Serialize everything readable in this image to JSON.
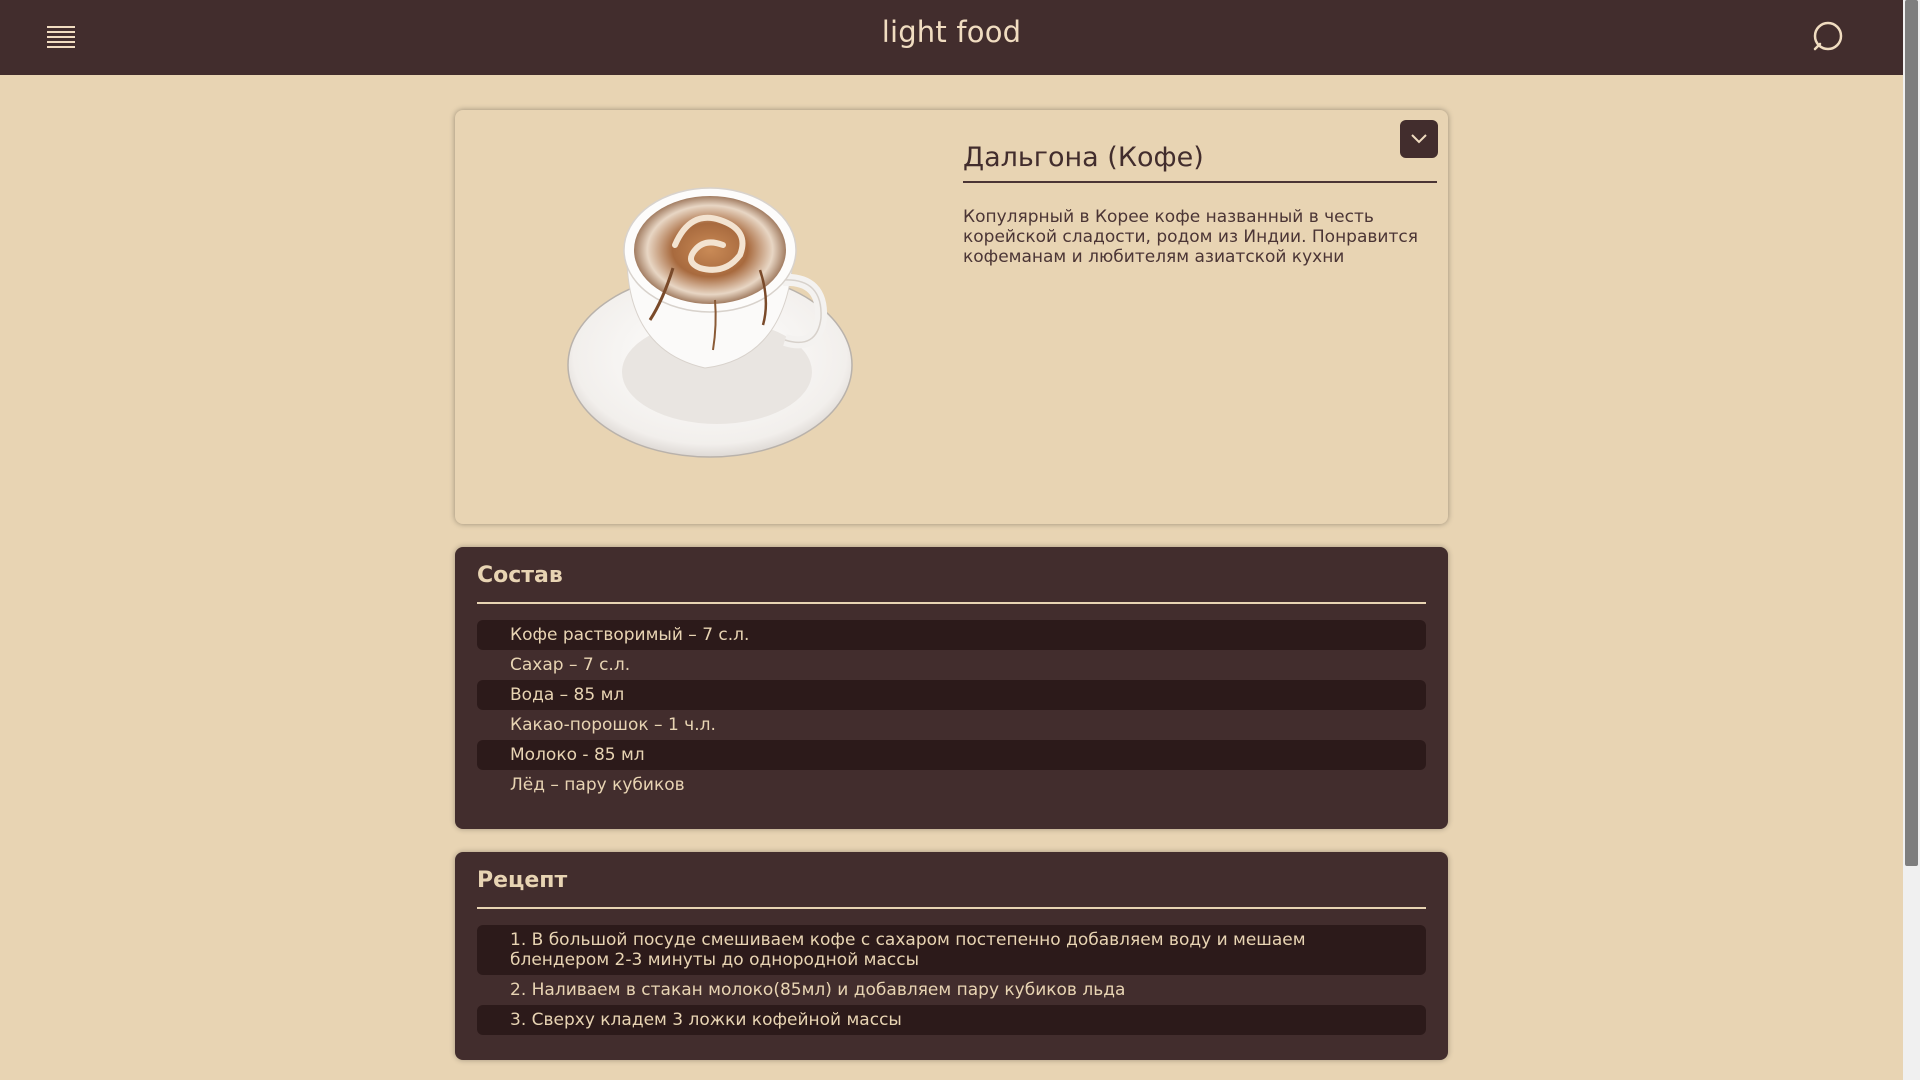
{
  "header": {
    "logo": "light food",
    "menu_icon": "hamburger-menu-icon",
    "search_icon": "search-icon"
  },
  "dish": {
    "title": "Дальгона (Кофе)",
    "description": "Копулярный в Корее кофе названный в честь корейской сладости, родом из Индии. Понравится кофеманам и любителям азиатской кухни",
    "image": "coffee-cup-image",
    "collapse_icon": "chevron-down-icon"
  },
  "ingredients": {
    "title": "Состав",
    "items": [
      "Кофе растворимый – 7 с.л.",
      "Сахар – 7 с.л.",
      "Вода – 85 мл",
      "Какао-порошок – 1 ч.л.",
      "Молоко - 85 мл",
      "Лёд – пару кубиков"
    ]
  },
  "recipe": {
    "title": "Рецепт",
    "steps": [
      "1. В большой посуде смешиваем кофе с сахаром постепенно добавляем воду и мешаем блендером 2-3 минуты до однородной массы",
      "2. Наливаем в стакан молоко(85мл) и добавляем пару кубиков льда",
      "3. Сверху кладем 3 ложки кофейной массы"
    ]
  },
  "colors": {
    "header_bg": "#422d2d",
    "page_bg": "#e8d4b3",
    "row_dark": "#2c1a1a",
    "text_light": "#e8d4b3"
  }
}
